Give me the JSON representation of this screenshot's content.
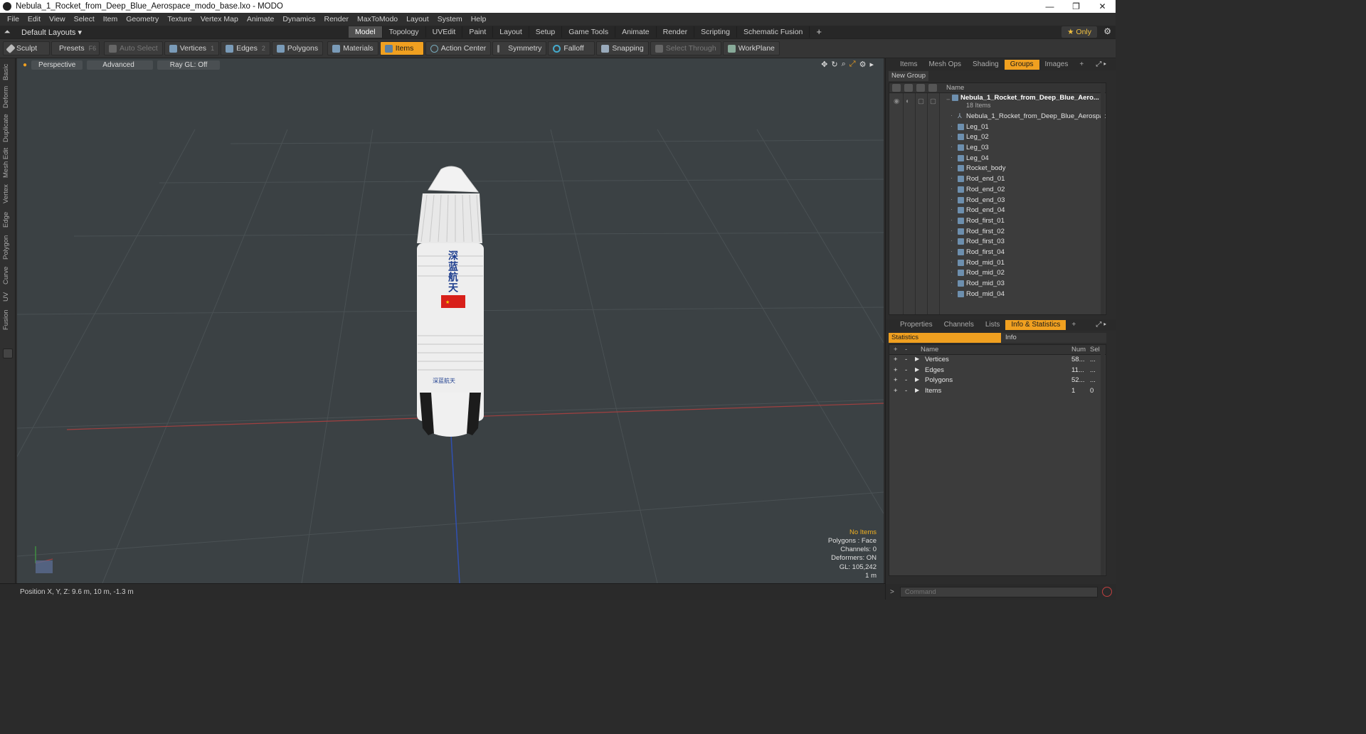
{
  "window": {
    "title": "Nebula_1_Rocket_from_Deep_Blue_Aerospace_modo_base.lxo - MODO",
    "controls": [
      "—",
      "❐",
      "✕"
    ]
  },
  "menu": [
    "File",
    "Edit",
    "View",
    "Select",
    "Item",
    "Geometry",
    "Texture",
    "Vertex Map",
    "Animate",
    "Dynamics",
    "Render",
    "MaxToModo",
    "Layout",
    "System",
    "Help"
  ],
  "layout_bar": {
    "layout_name": "Default Layouts ▾",
    "tabs": [
      "Model",
      "Topology",
      "UVEdit",
      "Paint",
      "Layout",
      "Setup",
      "Game Tools",
      "Animate",
      "Render",
      "Scripting",
      "Schematic Fusion"
    ],
    "active_tab": "Model",
    "add": "+",
    "only_label": "★  Only"
  },
  "toolbar": {
    "sculpt": "Sculpt",
    "presets": "Presets",
    "presets_key": "F6",
    "auto_select": "Auto Select",
    "vertices": "Vertices",
    "vertices_num": "1",
    "edges": "Edges",
    "edges_num": "2",
    "polygons": "Polygons",
    "materials": "Materials",
    "items": "Items",
    "action_center": "Action Center",
    "symmetry": "Symmetry",
    "falloff": "Falloff",
    "snapping": "Snapping",
    "select_through": "Select Through",
    "workplane": "WorkPlane"
  },
  "left_tabs": [
    "Basic",
    "Deform",
    "Duplicate",
    "Mesh Edit",
    "Vertex",
    "Edge",
    "Polygon",
    "Curve",
    "UV",
    "Fusion"
  ],
  "viewport": {
    "view": "Perspective",
    "shading": "Advanced",
    "raygl": "Ray GL: Off",
    "info": {
      "selection": "No Items",
      "polygons": "Polygons : Face",
      "channels": "Channels: 0",
      "deformers": "Deformers: ON",
      "gl": "GL: 105,242",
      "scale": "1 m"
    },
    "rocket_text": "深蓝航天",
    "rocket_logo": "深蓝航天"
  },
  "status": {
    "position": "Position X, Y, Z:   9.6 m, 10 m, -1.3 m"
  },
  "top_tabs": [
    "Items",
    "Mesh Ops",
    "Shading",
    "Groups",
    "Images"
  ],
  "top_tabs_active": "Groups",
  "groups": {
    "new_group": "New Group",
    "col_name": "Name",
    "root_name": "Nebula_1_Rocket_from_Deep_Blue_Aero...",
    "root_count": "18 Items",
    "items": [
      "Nebula_1_Rocket_from_Deep_Blue_Aerospace",
      "Leg_01",
      "Leg_02",
      "Leg_03",
      "Leg_04",
      "Rocket_body",
      "Rod_end_01",
      "Rod_end_02",
      "Rod_end_03",
      "Rod_end_04",
      "Rod_first_01",
      "Rod_first_02",
      "Rod_first_03",
      "Rod_first_04",
      "Rod_mid_01",
      "Rod_mid_02",
      "Rod_mid_03",
      "Rod_mid_04"
    ]
  },
  "bottom_tabs": [
    "Properties",
    "Channels",
    "Lists",
    "Info & Statistics"
  ],
  "bottom_tabs_active": "Info & Statistics",
  "stats": {
    "tab_statistics": "Statistics",
    "tab_info": "Info",
    "col_name": "Name",
    "col_num": "Num",
    "col_sel": "Sel",
    "rows": [
      {
        "name": "Vertices",
        "num": "58...",
        "sel": "..."
      },
      {
        "name": "Edges",
        "num": "11...",
        "sel": "..."
      },
      {
        "name": "Polygons",
        "num": "52...",
        "sel": "..."
      },
      {
        "name": "Items",
        "num": "1",
        "sel": "0"
      }
    ]
  },
  "command": {
    "prompt": ">",
    "placeholder": "Command"
  },
  "colors": {
    "accent": "#f0a020",
    "viewport_bg": "#3b4144",
    "x_axis": "#b04040",
    "z_axis": "#3050b0"
  }
}
